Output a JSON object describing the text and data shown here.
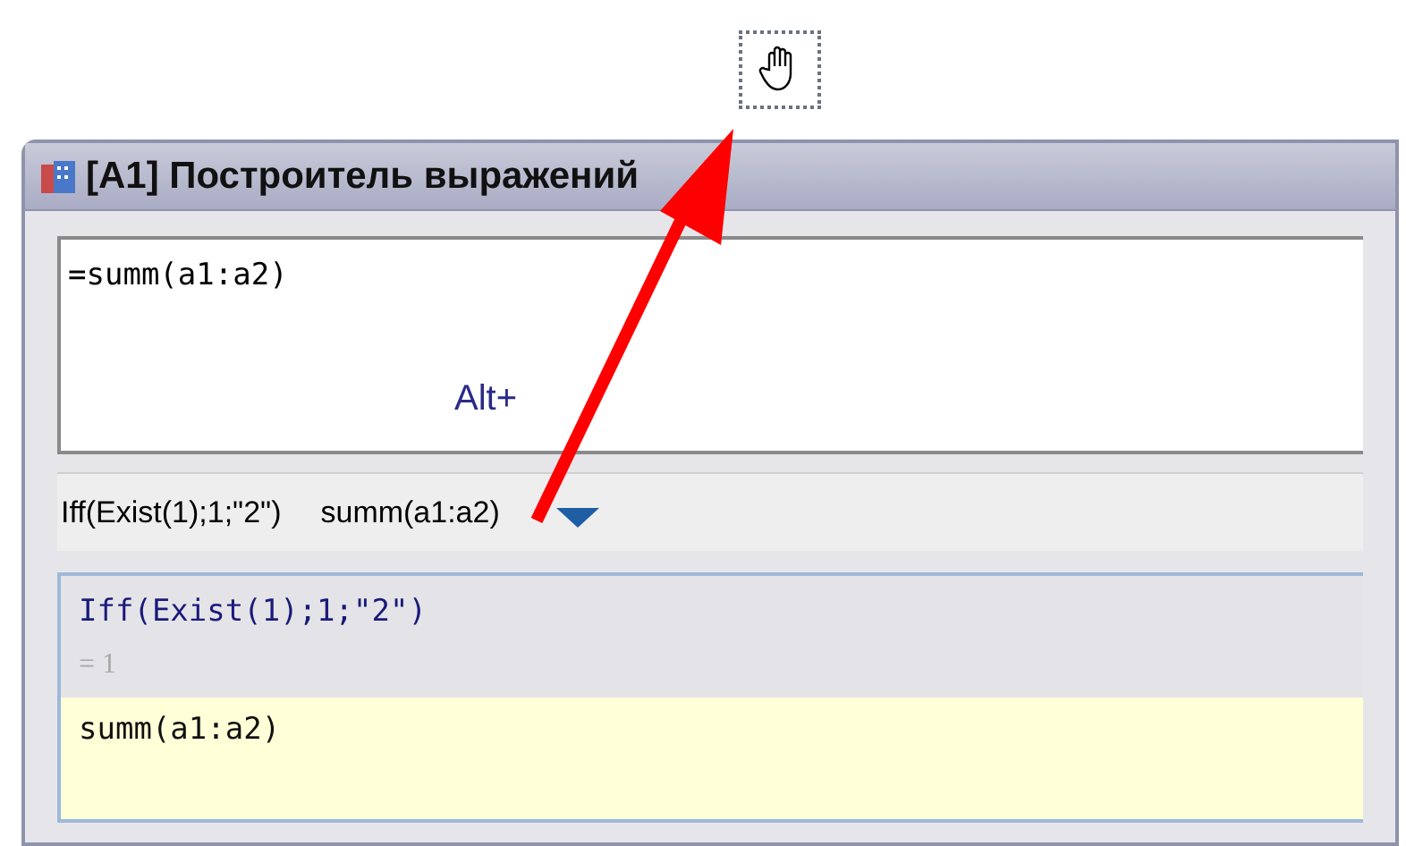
{
  "window": {
    "title": "[A1] Построитель выражений"
  },
  "editor": {
    "value": "=summ(a1:a2)",
    "hint": "Alt+"
  },
  "history": [
    {
      "label": "Iff(Exist(1);1;\"2\")"
    },
    {
      "label": "summ(a1:a2)"
    }
  ],
  "results": [
    {
      "expression": "Iff(Exist(1);1;\"2\")",
      "value": "= 1",
      "selected": false
    },
    {
      "expression": "summ(a1:a2)",
      "selected": true
    }
  ]
}
